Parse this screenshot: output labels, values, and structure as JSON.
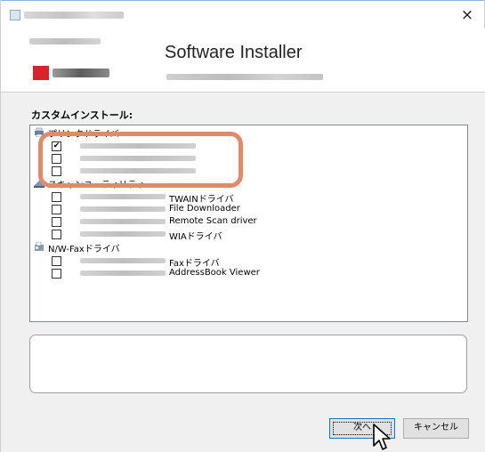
{
  "window": {
    "close_glyph": "×"
  },
  "header": {
    "app_title": "Software Installer"
  },
  "main": {
    "section_label": "カスタムインストール:",
    "groups": [
      {
        "label": "プリンタドライバ",
        "items": [
          {
            "checked": true,
            "label": ""
          },
          {
            "checked": false,
            "label": ""
          },
          {
            "checked": false,
            "label": ""
          }
        ]
      },
      {
        "label": "スキャンユーティリティ",
        "items": [
          {
            "checked": false,
            "label": "TWAINドライバ"
          },
          {
            "checked": false,
            "label": "File Downloader"
          },
          {
            "checked": false,
            "label": "Remote Scan driver"
          },
          {
            "checked": false,
            "label": "WIAドライバ"
          }
        ]
      },
      {
        "label": "N/W-Faxドライバ",
        "items": [
          {
            "checked": false,
            "label": "Faxドライバ"
          },
          {
            "checked": false,
            "label": "AddressBook Viewer"
          }
        ]
      }
    ]
  },
  "buttons": {
    "next_label": "次へ",
    "cancel_label": "キャンセル"
  },
  "colors": {
    "highlight": "#e08a6b",
    "brand_red": "#d8232a",
    "focus_border": "#0078d7"
  }
}
